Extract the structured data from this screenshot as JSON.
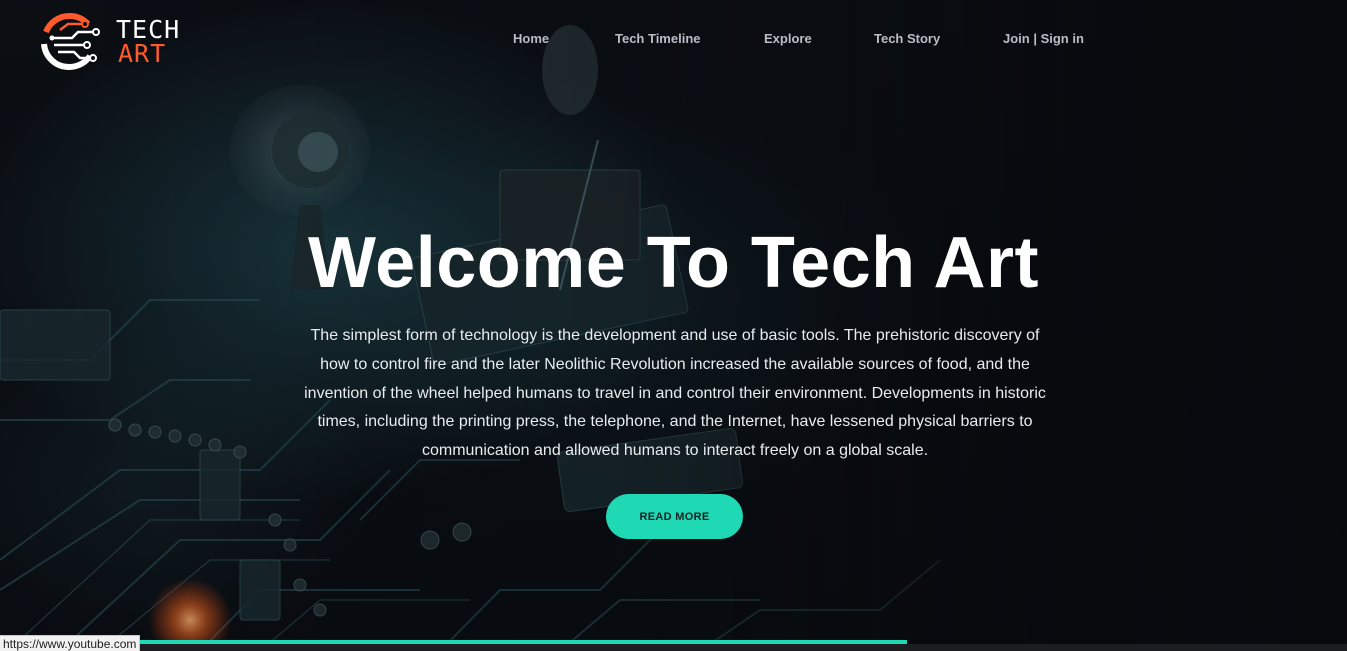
{
  "brand": {
    "line1": "TECH",
    "line2": "ART",
    "accent_color": "#ff5a2c"
  },
  "nav": {
    "items": [
      {
        "label": "Home"
      },
      {
        "label": "Tech Timeline"
      },
      {
        "label": "Explore"
      },
      {
        "label": "Tech Story"
      },
      {
        "label": "Join | Sign in"
      }
    ]
  },
  "hero": {
    "title": "Welcome To Tech Art",
    "description": "The simplest form of technology is the development and use of basic tools. The prehistoric discovery of how to control fire and the later Neolithic Revolution increased the available sources of food, and the invention of the wheel helped humans to travel in and control their environment. Developments in historic times, including the printing press, the telephone, and the Internet, have lessened physical barriers to communication and allowed humans to interact freely on a global scale.",
    "button_label": "READ MORE",
    "button_color": "#1ed9b4"
  },
  "progress": {
    "fraction": 0.673
  },
  "status_bar": {
    "url": "https://www.youtube.com"
  }
}
